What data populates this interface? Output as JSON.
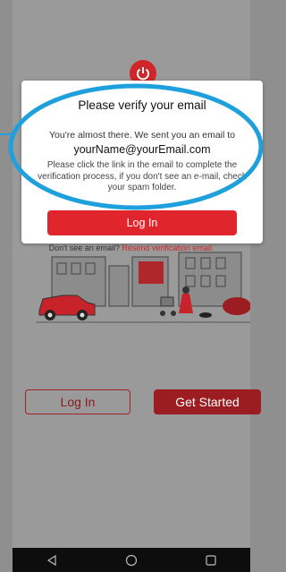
{
  "dialog": {
    "title": "Please verify your email",
    "body_line1": "You're almost there. We sent you an email to",
    "email": "yourName@yourEmail.com",
    "body_line2": "Please click the link in the email to complete the verification process, if you don't see an e-mail, check your spam folder.",
    "login_label": "Log In",
    "footer_text": "Don't see an email?",
    "footer_link": "Resend verification email."
  },
  "main": {
    "login_label": "Log In",
    "get_started_label": "Get Started"
  },
  "icons": {
    "power": "power-icon",
    "back": "nav-back-icon",
    "home": "nav-home-icon",
    "recents": "nav-recents-icon"
  },
  "colors": {
    "brand_red": "#e0262c",
    "dark_red": "#9b1d21",
    "annotation_blue": "#1ea0dc"
  }
}
